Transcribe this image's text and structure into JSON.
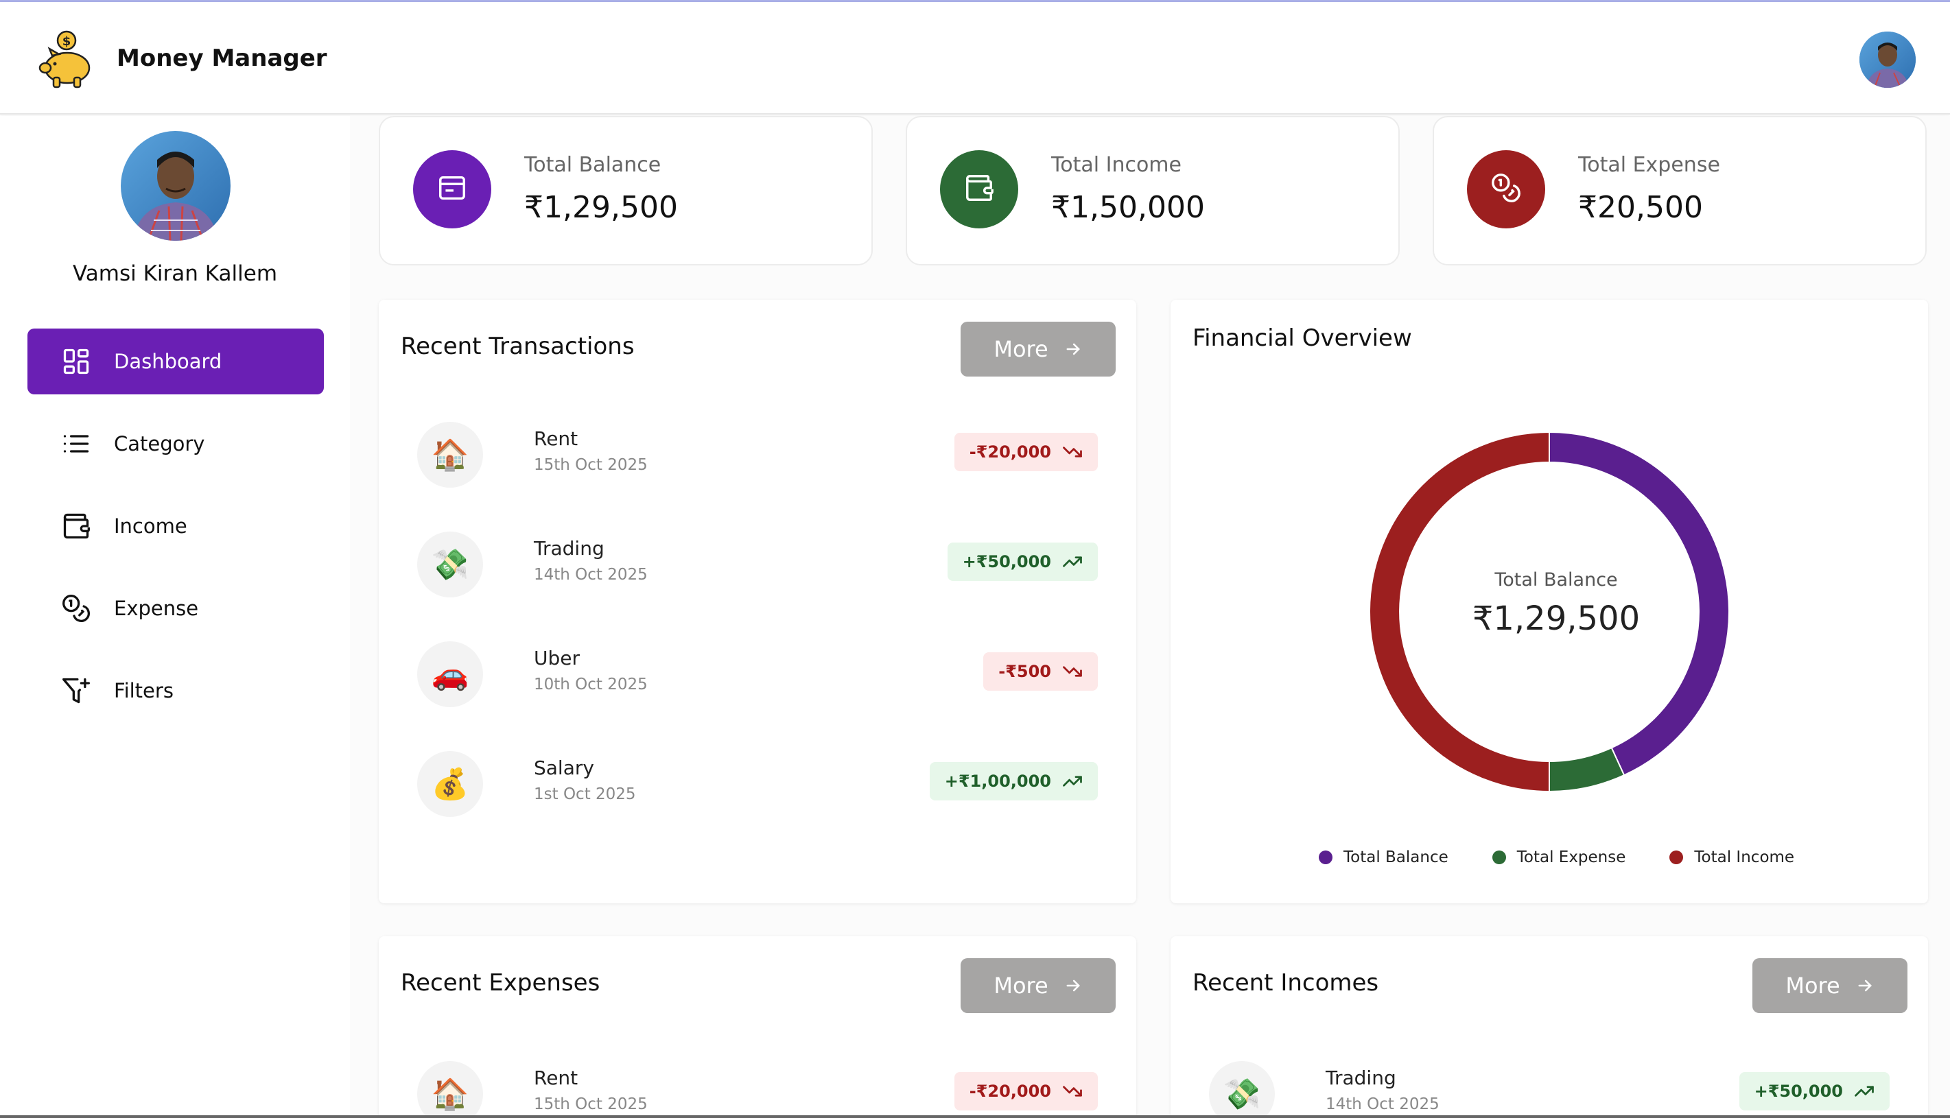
{
  "app": {
    "title": "Money Manager"
  },
  "colors": {
    "brand": "#6a1fb4",
    "income": "#2c6b36",
    "expense": "#9c1f1f",
    "more_button": "#a6a5a4"
  },
  "user": {
    "name": "Vamsi Kiran Kallem"
  },
  "sidebar": {
    "items": [
      {
        "label": "Dashboard",
        "icon": "dashboard-grid-icon",
        "active": true
      },
      {
        "label": "Category",
        "icon": "list-icon",
        "active": false
      },
      {
        "label": "Income",
        "icon": "wallet-icon",
        "active": false
      },
      {
        "label": "Expense",
        "icon": "coins-icon",
        "active": false
      },
      {
        "label": "Filters",
        "icon": "filter-plus-icon",
        "active": false
      }
    ]
  },
  "stats": {
    "balance": {
      "label": "Total Balance",
      "value": "₹1,29,500"
    },
    "income": {
      "label": "Total Income",
      "value": "₹1,50,000"
    },
    "expense": {
      "label": "Total Expense",
      "value": "₹20,500"
    }
  },
  "recent_transactions": {
    "title": "Recent Transactions",
    "more_label": "More",
    "items": [
      {
        "name": "Rent",
        "date": "15th Oct 2025",
        "amount": "-₹20,000",
        "type": "expense",
        "emoji": "🏠"
      },
      {
        "name": "Trading",
        "date": "14th Oct 2025",
        "amount": "+₹50,000",
        "type": "income",
        "emoji": "💸"
      },
      {
        "name": "Uber",
        "date": "10th Oct 2025",
        "amount": "-₹500",
        "type": "expense",
        "emoji": "🚗"
      },
      {
        "name": "Salary",
        "date": "1st Oct 2025",
        "amount": "+₹1,00,000",
        "type": "income",
        "emoji": "💰"
      }
    ]
  },
  "financial_overview": {
    "title": "Financial Overview",
    "center_label": "Total Balance",
    "center_value": "₹1,29,500",
    "legend": [
      {
        "label": "Total Balance",
        "color": "#5a1f8f"
      },
      {
        "label": "Total Expense",
        "color": "#2c6b36"
      },
      {
        "label": "Total Income",
        "color": "#9c1f1f"
      }
    ]
  },
  "chart_data": {
    "type": "pie",
    "categories": [
      "Total Balance",
      "Total Expense",
      "Total Income"
    ],
    "values": [
      129500,
      20500,
      150000
    ],
    "title": "Financial Overview"
  },
  "recent_expenses": {
    "title": "Recent Expenses",
    "more_label": "More",
    "items": [
      {
        "name": "Rent",
        "date": "15th Oct 2025",
        "amount": "-₹20,000",
        "type": "expense",
        "emoji": "🏠"
      }
    ]
  },
  "recent_incomes": {
    "title": "Recent Incomes",
    "more_label": "More",
    "items": [
      {
        "name": "Trading",
        "date": "14th Oct 2025",
        "amount": "+₹50,000",
        "type": "income",
        "emoji": "💸"
      }
    ]
  }
}
